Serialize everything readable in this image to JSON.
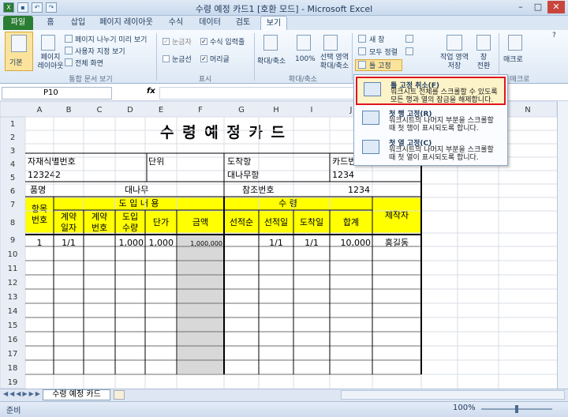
{
  "window": {
    "title": "수령 예정 카드1 [호환 모드] - Microsoft Excel"
  },
  "tabs": [
    "파일",
    "홈",
    "삽입",
    "페이지 레이아웃",
    "수식",
    "데이터",
    "검토",
    "보기"
  ],
  "ribbon": {
    "views": {
      "normal": "기본",
      "page_layout": "페이지\n레이아웃",
      "page_break": "페이지 나누기 미리 보기",
      "custom": "사용자 지정 보기",
      "fullscreen": "전체 화면",
      "group": "통합 문서 보기"
    },
    "show": {
      "ruler": "눈금자",
      "formula_bar": "수식 입력줄",
      "gridlines": "눈금선",
      "headings": "머리글",
      "group": "표시"
    },
    "zoom": {
      "zoom": "확대/축소",
      "hundred": "100%",
      "selection": "선택 영역\n확대/축소",
      "group": "확대/축소"
    },
    "window": {
      "new": "새 창",
      "arrange": "모두 정렬",
      "freeze": "틀 고정",
      "workspace": "작업 영역\n저장",
      "switch": "창\n전환"
    },
    "macro": {
      "label": "매크로",
      "group": "매크로"
    }
  },
  "formula": {
    "namebox": "P10",
    "fx": "fx"
  },
  "columns": [
    "A",
    "B",
    "C",
    "D",
    "E",
    "F",
    "G",
    "H",
    "I",
    "J",
    "",
    "",
    "",
    "N"
  ],
  "rows": [
    "1",
    "2",
    "3",
    "4",
    "5",
    "6",
    "7",
    "8",
    "9",
    "10",
    "11",
    "12",
    "13",
    "14",
    "15",
    "16",
    "17",
    "18",
    "19"
  ],
  "sheet": {
    "title": "수 령 예 정 카 드",
    "r4a": "자재식별번호",
    "r4b": "단위",
    "r4c": "도착항",
    "r4d": "카드번",
    "r5a": "123242",
    "r5c": "대나무항",
    "r5d": "1234",
    "r6a": "품명",
    "r6b": "대나무",
    "r6c": "참조번호",
    "r6d": "1234",
    "h_item": "항목\n번호",
    "h_intro": "도 입 내 용",
    "h_recv": "수          령",
    "h_c1": "계약\n일자",
    "h_c2": "계약\n번호",
    "h_c3": "도입\n수량",
    "h_c4": "단가",
    "h_c5": "금액",
    "h_r1": "선적순",
    "h_r2": "선적일",
    "h_r3": "도착일",
    "h_r4": "합계",
    "h_maker": "제작자",
    "d_item": "1",
    "d_date": "1/1",
    "d_qty": "1,000",
    "d_price": "1,000",
    "d_amount": "1,000,000",
    "d_ship": "1/1",
    "d_arr": "1/1",
    "d_total": "10,000",
    "d_maker": "홍길동"
  },
  "freeze_menu": [
    {
      "title": "틀 고정 취소(F)",
      "desc1": "워크시트 전체를 스크롤할 수 있도록",
      "desc2": "모든 행과 열의 잠금을 해제합니다."
    },
    {
      "title": "첫 행 고정(R)",
      "desc1": "워크시트의 나머지 부분을 스크롤할",
      "desc2": "때 첫 행이 표시되도록 합니다."
    },
    {
      "title": "첫 열 고정(C)",
      "desc1": "워크시트의 나머지 부분을 스크롤할",
      "desc2": "때 첫 열이 표시되도록 합니다."
    }
  ],
  "sheet_tab": "수령 예정 카드",
  "status": {
    "ready": "준비",
    "zoom": "100%"
  },
  "colors": {
    "file_tab": "#2a7d32",
    "highlight": "#ffff00",
    "menu_border": "#e0141e"
  }
}
